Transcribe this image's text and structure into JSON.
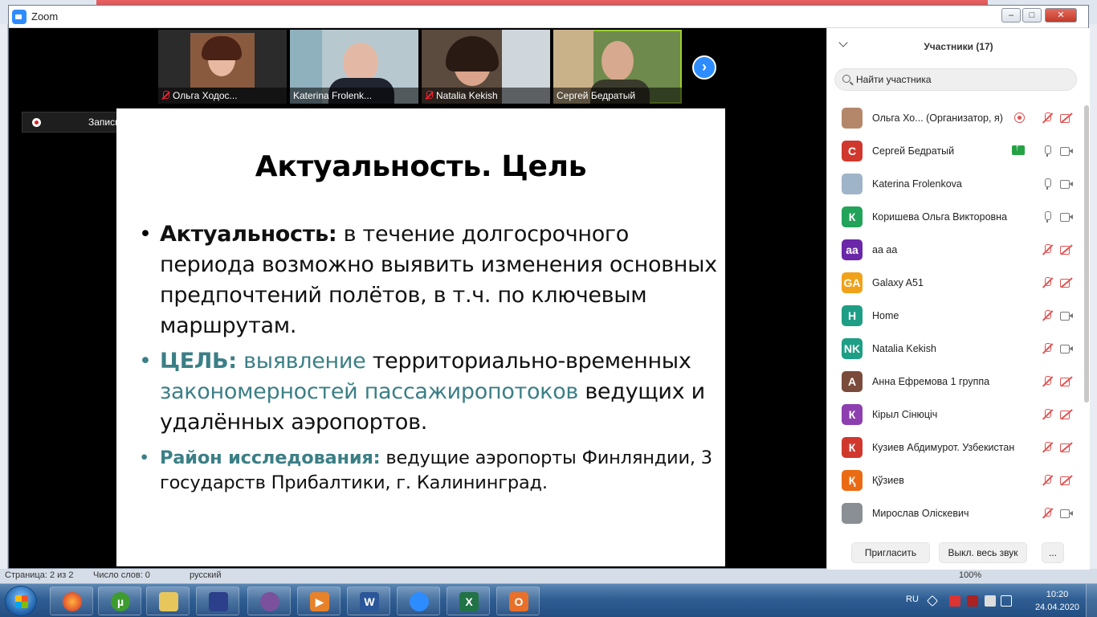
{
  "zoom": {
    "title": "Zoom",
    "recording_label": "Запись..."
  },
  "video_strip": [
    {
      "name": "Ольга Ходос...",
      "muted": true
    },
    {
      "name": "Katerina Frolenk...",
      "muted": false
    },
    {
      "name": "Natalia Kekish",
      "muted": true
    },
    {
      "name": "Сергей Бедратый",
      "muted": false,
      "active": true
    }
  ],
  "slide": {
    "title": "Актуальность. Цель",
    "b1_label": "Актуальность:",
    "b1_text": " в течение долгосрочного периода возможно выявить изменения основных предпочтений полётов, в т.ч. по ключевым маршрутам.",
    "b2_label": "ЦЕЛЬ:",
    "b2_part1": " выявление",
    "b2_part2": " территориально-временных ",
    "b2_part3": "закономерностей пассажиропотоков",
    "b2_part4": " ведущих и удалённых аэропортов.",
    "b3_label": "Район исследования:",
    "b3_text": " ведущие аэропорты Финляндии, 3 государств Прибалтики, г. Калининград."
  },
  "participants": {
    "title": "Участники (17)",
    "search_placeholder": "Найти участника",
    "invite_label": "Пригласить",
    "mute_all_label": "Выкл. весь звук",
    "more_label": "...",
    "list": [
      {
        "initials": "",
        "name": "Ольга Хо...  (Организатор, я)",
        "avatar_color": "#b5876a",
        "photo": true,
        "recording": true,
        "mic": "off",
        "cam": "off"
      },
      {
        "initials": "С",
        "name": "Сергей Бедратый",
        "avatar_color": "#d1382d",
        "sharing": true,
        "mic": "on",
        "cam": "on"
      },
      {
        "initials": "",
        "name": "Katerina Frolenkova",
        "avatar_color": "#9fb4c8",
        "photo": true,
        "mic": "on",
        "cam": "on"
      },
      {
        "initials": "К",
        "name": "Коришева Ольга Викторовна",
        "avatar_color": "#22a35a",
        "mic": "on",
        "cam": "on"
      },
      {
        "initials": "aa",
        "name": "aa aa",
        "avatar_color": "#6a27a8",
        "mic": "off",
        "cam": "off"
      },
      {
        "initials": "GA",
        "name": "Galaxy A51",
        "avatar_color": "#f0a21a",
        "mic": "off",
        "cam": "off"
      },
      {
        "initials": "H",
        "name": "Home",
        "avatar_color": "#1f9e86",
        "mic": "off",
        "cam": "on"
      },
      {
        "initials": "NK",
        "name": "Natalia Kekish",
        "avatar_color": "#1f9e86",
        "mic": "off",
        "cam": "on"
      },
      {
        "initials": "А",
        "name": "Анна Ефремова 1 группа",
        "avatar_color": "#7a4b3a",
        "mic": "off",
        "cam": "off"
      },
      {
        "initials": "К",
        "name": "Кірыл Сінюціч",
        "avatar_color": "#8d3fb0",
        "mic": "off",
        "cam": "off"
      },
      {
        "initials": "К",
        "name": "Кузиев Абдимурот. Узбекистан",
        "avatar_color": "#d1382d",
        "mic": "off",
        "cam": "off"
      },
      {
        "initials": "Қ",
        "name": "Қўзиев",
        "avatar_color": "#ea6b14",
        "mic": "off",
        "cam": "off"
      },
      {
        "initials": "",
        "name": "Мирослав Оліскевич",
        "avatar_color": "#8a8f96",
        "photo": true,
        "mic": "off",
        "cam": "on"
      }
    ]
  },
  "word_status": {
    "page": "Страница: 2 из 2",
    "words": "Число слов: 0",
    "lang": "русский",
    "zoom": "100%"
  },
  "tray": {
    "lang": "RU",
    "time": "10:20",
    "date": "24.04.2020"
  }
}
